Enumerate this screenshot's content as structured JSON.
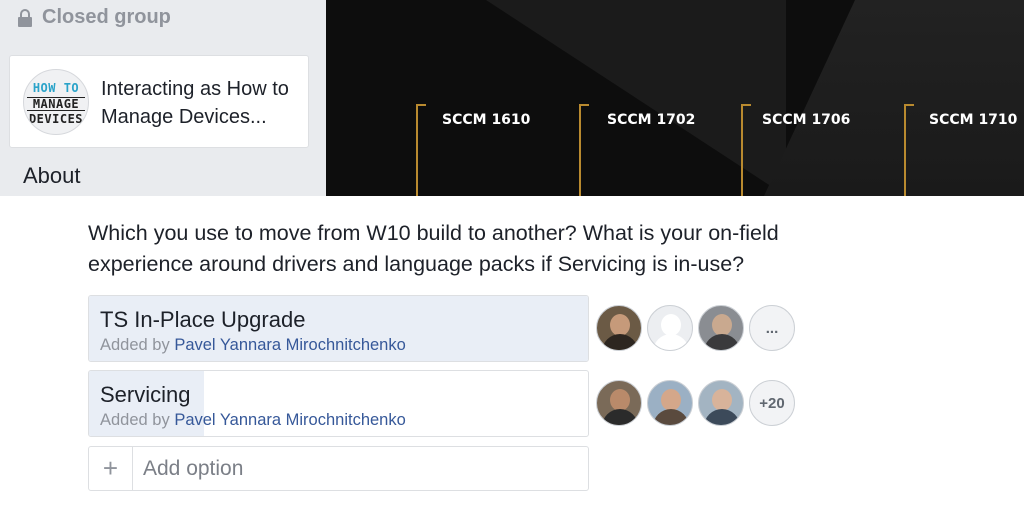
{
  "sidebar": {
    "group_type": "Closed group",
    "interacting_as": "Interacting as How to Manage Devices...",
    "page_logo": {
      "line1": "HOW TO",
      "line2": "MANAGE",
      "line3": "DEVICES"
    },
    "about_label": "About"
  },
  "cover": {
    "timeline": [
      "SCCM 1610",
      "SCCM 1702",
      "SCCM 1706",
      "SCCM 1710"
    ],
    "accent_color": "#b98a2f"
  },
  "poll": {
    "question": "Which you use to move from W10 build to another? What is your on-field experience around drivers and language packs if Servicing is in-use?",
    "options": [
      {
        "label": "TS In-Place Upgrade",
        "added_prefix": "Added by",
        "added_by": "Pavel Yannara Mirochnitchenko",
        "more_voters_label": "...",
        "vote_share": 1.0
      },
      {
        "label": "Servicing",
        "added_prefix": "Added by",
        "added_by": "Pavel Yannara Mirochnitchenko",
        "more_voters_label": "+20",
        "vote_share": 0.23
      }
    ],
    "add_option_placeholder": "Add option"
  }
}
